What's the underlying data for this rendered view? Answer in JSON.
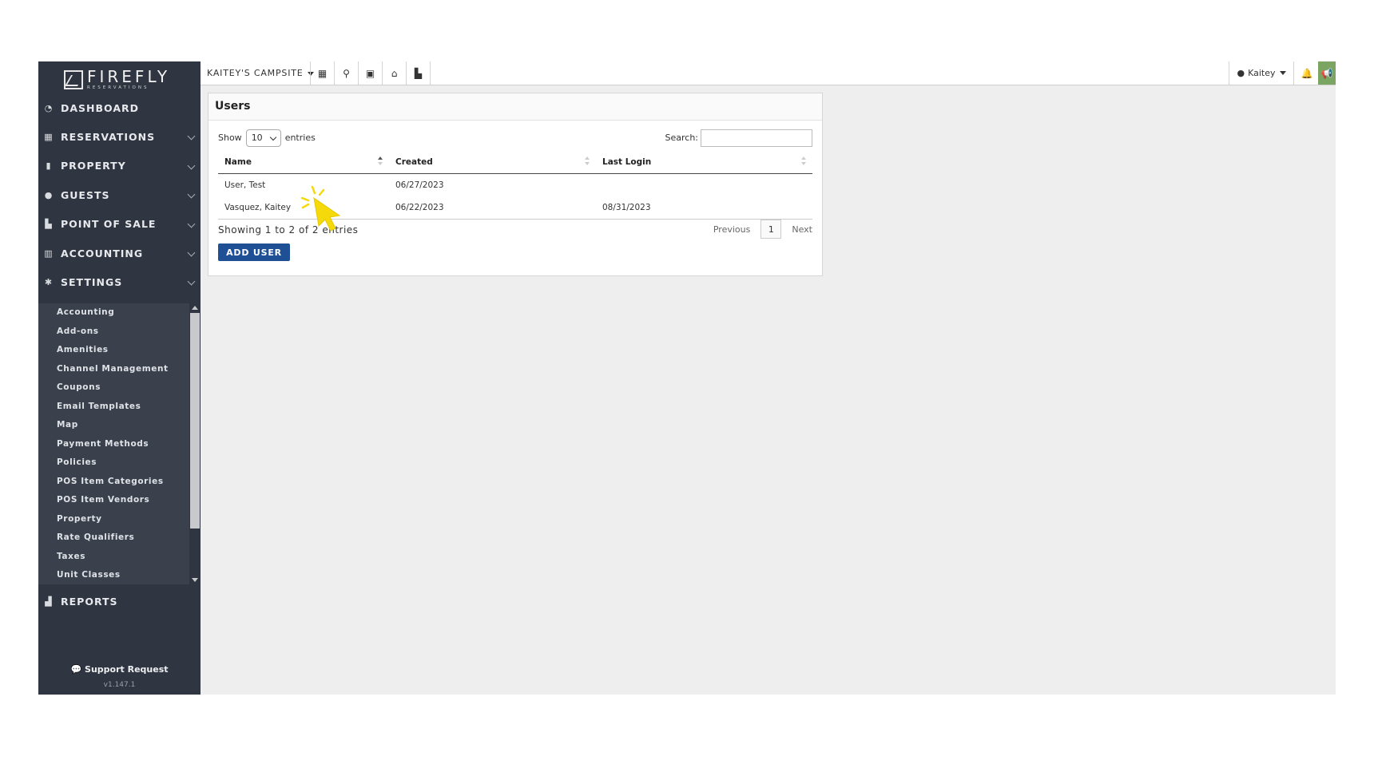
{
  "sidebar": {
    "logo": {
      "brand": "FIREFLY",
      "sub": "RESERVATIONS"
    },
    "items": [
      {
        "label": "DASHBOARD",
        "icon": "gauge-icon"
      },
      {
        "label": "RESERVATIONS",
        "icon": "calendar-icon"
      },
      {
        "label": "PROPERTY",
        "icon": "building-icon"
      },
      {
        "label": "GUESTS",
        "icon": "user-icon"
      },
      {
        "label": "POINT OF SALE",
        "icon": "cash-register-icon"
      },
      {
        "label": "ACCOUNTING",
        "icon": "bank-icon"
      },
      {
        "label": "SETTINGS",
        "icon": "gear-icon"
      }
    ],
    "settings_submenu": [
      "Accounting",
      "Add-ons",
      "Amenities",
      "Channel Management",
      "Coupons",
      "Email Templates",
      "Map",
      "Payment Methods",
      "Policies",
      "POS Item Categories",
      "POS Item Vendors",
      "Property",
      "Rate Qualifiers",
      "Taxes",
      "Unit Classes"
    ],
    "reports": "REPORTS",
    "support": "Support Request",
    "version": "v1.147.1"
  },
  "topbar": {
    "site": "KAITEY'S CAMPSITE",
    "user": "Kaitey"
  },
  "users_panel": {
    "title": "Users",
    "show_label": "Show",
    "entries_value": "10",
    "entries_label": "entries",
    "search_label": "Search:",
    "columns": [
      "Name",
      "Created",
      "Last Login"
    ],
    "rows": [
      [
        "User, Test",
        "06/27/2023",
        ""
      ],
      [
        "Vasquez, Kaitey",
        "06/22/2023",
        "08/31/2023"
      ]
    ],
    "info": "Showing 1 to 2 of 2 entries",
    "previous": "Previous",
    "page": "1",
    "next": "Next",
    "add_button": "ADD USER"
  },
  "colors": {
    "sidebar": "#2f3541",
    "submenu": "#3a414d",
    "primary_button": "#1f4f95",
    "announce": "#7aa563",
    "cursor": "#f5d90a"
  }
}
